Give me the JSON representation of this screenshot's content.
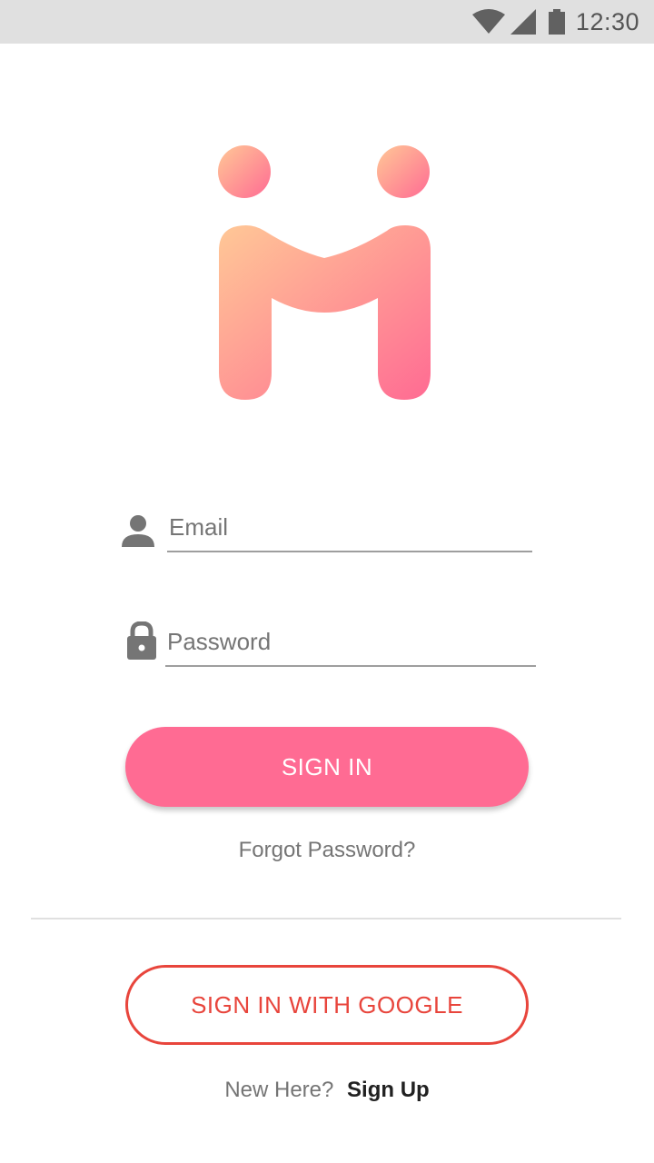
{
  "status_bar": {
    "time": "12:30",
    "icons": [
      "wifi-icon",
      "signal-icon",
      "battery-icon"
    ]
  },
  "logo": {
    "icon": "app-logo-m-icon",
    "gradient": [
      "#ffc896",
      "#ff6b93"
    ]
  },
  "form": {
    "email": {
      "icon": "person-icon",
      "placeholder": "Email",
      "value": ""
    },
    "password": {
      "icon": "lock-icon",
      "placeholder": "Password",
      "value": ""
    },
    "signin_label": "SIGN IN",
    "forgot_label": "Forgot Password?"
  },
  "google": {
    "label": "SIGN IN WITH GOOGLE"
  },
  "signup": {
    "prompt": "New Here?",
    "link": "Sign Up"
  },
  "colors": {
    "accent": "#ff6b93",
    "google": "#e8453c",
    "muted": "#757575"
  }
}
